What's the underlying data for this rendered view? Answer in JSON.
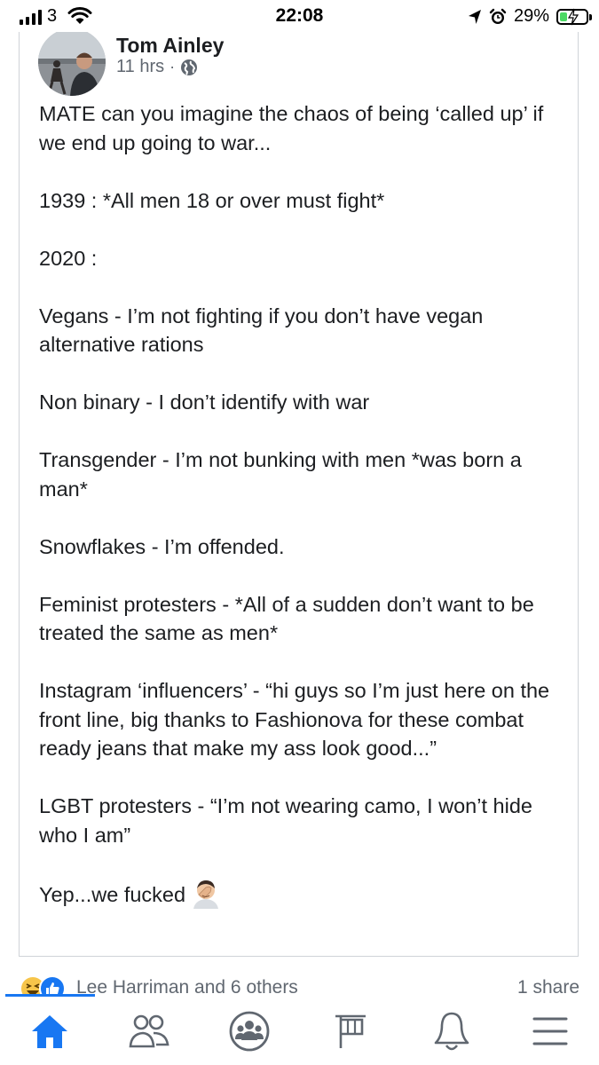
{
  "status_bar": {
    "carrier": "3",
    "time": "22:08",
    "battery_percent": "29%",
    "battery_level": 0.29,
    "icons": [
      "signal-icon",
      "wifi-icon",
      "location-icon",
      "alarm-icon",
      "battery-charging-icon"
    ]
  },
  "post": {
    "author": "Tom Ainley",
    "time_ago": "11 hrs",
    "separator": "·",
    "privacy_icon": "globe-icon",
    "paragraphs": [
      "MATE can you imagine the chaos of being ‘called up’ if we end up going to war...",
      "1939 : *All men 18 or over must fight*",
      "2020 :",
      "Vegans - I’m not fighting if you don’t have vegan alternative rations",
      "Non binary - I don’t identify with war",
      "Transgender - I’m not bunking with men *was born a man*",
      "Snowflakes - I’m offended.",
      "Feminist protesters - *All of a sudden don’t want to be treated the same as men*",
      "Instagram ‘influencers’ - “hi guys so I’m just here on the front line, big thanks to Fashionova for these combat ready jeans that make my ass look good...”",
      "LGBT protesters - “I’m not wearing camo, I won’t hide who I am”",
      "Yep...we fucked"
    ],
    "end_emoji": "man-facepalming-emoji"
  },
  "reactions": {
    "icons": [
      "haha-reaction-icon",
      "like-reaction-icon"
    ],
    "names": "Lee Harriman and 6 others",
    "shares": "1 share"
  },
  "bottom_nav": {
    "items": [
      "home-icon",
      "friends-icon",
      "groups-icon",
      "pages-flag-icon",
      "notifications-bell-icon",
      "menu-icon"
    ],
    "active": "home-icon",
    "accent": "#1877f2",
    "inactive": "#606770"
  }
}
